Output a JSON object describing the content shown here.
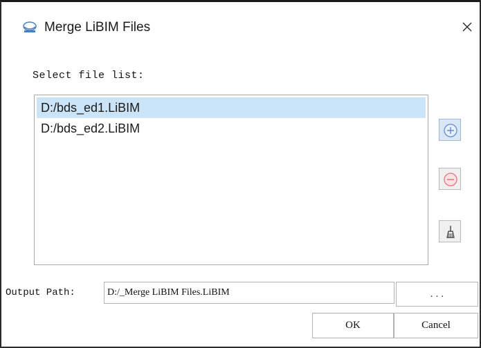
{
  "window": {
    "title": "Merge LiBIM Files",
    "close_glyph": "✕",
    "icon": "libim-app-icon"
  },
  "file_list": {
    "label": "Select file list:",
    "items": [
      {
        "path": "D:/bds_ed1.LiBIM",
        "selected": true
      },
      {
        "path": "D:/bds_ed2.LiBIM",
        "selected": false
      }
    ]
  },
  "side_buttons": {
    "add_icon": "plus-circle-icon",
    "remove_icon": "minus-circle-icon",
    "clear_icon": "broom-icon"
  },
  "output": {
    "label": "Output Path:",
    "value": "D:/_Merge LiBIM Files.LiBIM",
    "browse_label": "..."
  },
  "footer": {
    "ok_label": "OK",
    "cancel_label": "Cancel"
  },
  "colors": {
    "selection": "#cce4f7",
    "add_accent": "#5b8fd6",
    "remove_accent": "#e8737a"
  }
}
